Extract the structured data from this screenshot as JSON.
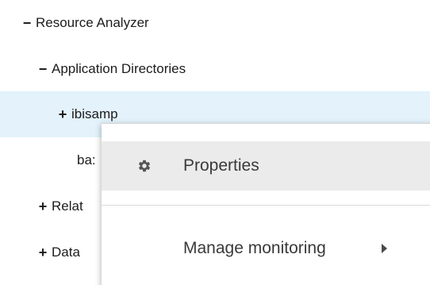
{
  "tree": {
    "items": [
      {
        "toggle": "−",
        "label": "Resource Analyzer"
      },
      {
        "toggle": "−",
        "label": "Application Directories"
      },
      {
        "toggle": "+",
        "label": "ibisamp"
      },
      {
        "toggle": "",
        "label": "ba:"
      },
      {
        "toggle": "+",
        "label": "Relat"
      },
      {
        "toggle": "+",
        "label": "Data"
      }
    ]
  },
  "context_menu": {
    "items": [
      {
        "label": "Properties",
        "icon": "gear-icon"
      },
      {
        "label": "Manage monitoring",
        "icon": "chevron-right-icon"
      }
    ]
  },
  "colors": {
    "selected_row": "#e3f2fb",
    "menu_highlight": "#ebebeb"
  }
}
